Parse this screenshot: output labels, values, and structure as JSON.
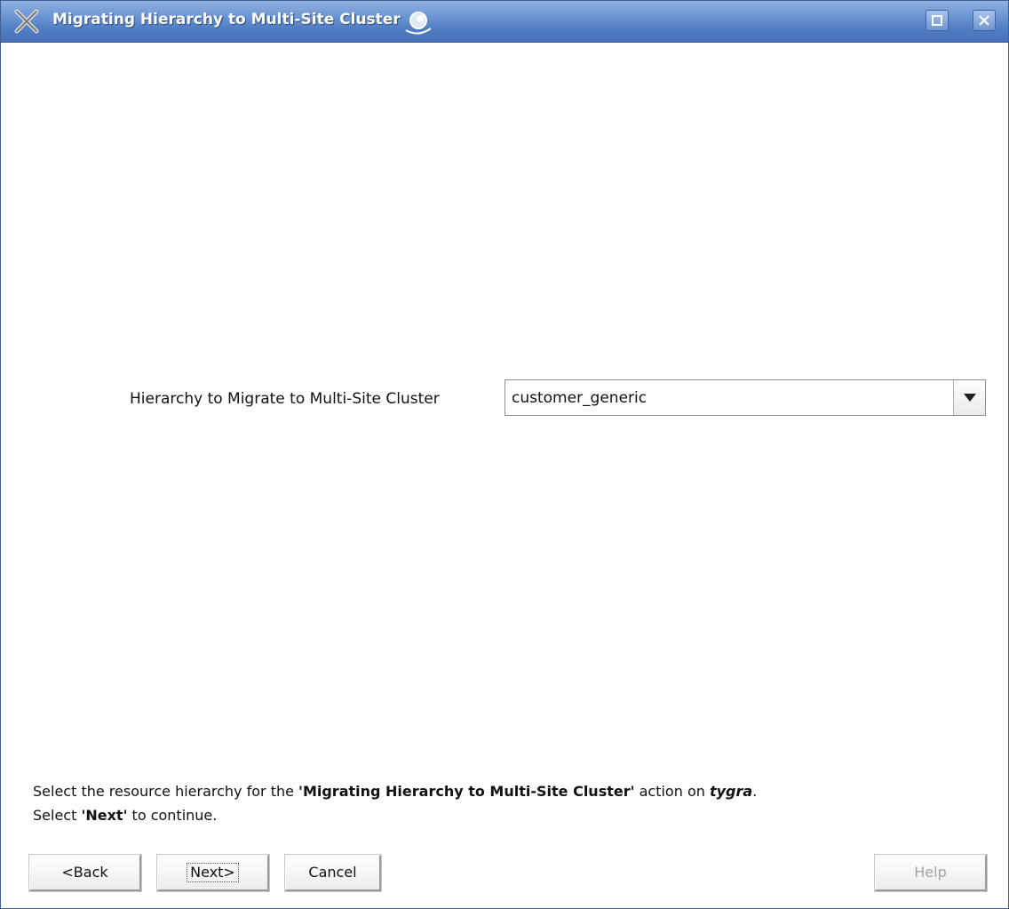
{
  "window": {
    "title": "Migrating Hierarchy to Multi-Site Cluster"
  },
  "form": {
    "hierarchy_label": "Hierarchy to Migrate to Multi-Site Cluster",
    "hierarchy_value": "customer_generic"
  },
  "instructions": {
    "line1_prefix": "Select the resource hierarchy for the ",
    "line1_action": "'Migrating Hierarchy to Multi-Site Cluster'",
    "line1_middle": " action on ",
    "line1_server": "tygra",
    "line1_suffix": ".",
    "line2_prefix": "Select ",
    "line2_next": "'Next'",
    "line2_suffix": " to continue."
  },
  "buttons": {
    "back": "<Back",
    "next": "Next>",
    "cancel": "Cancel",
    "help": "Help"
  },
  "icons": {
    "app": "app-x-icon",
    "busy": "busy-indicator-icon",
    "maximize": "maximize-icon",
    "close": "close-icon",
    "dropdown": "chevron-down-icon"
  },
  "colors": {
    "titlebar": "#4f7cc2",
    "disabled_text": "#a3a3a3"
  }
}
